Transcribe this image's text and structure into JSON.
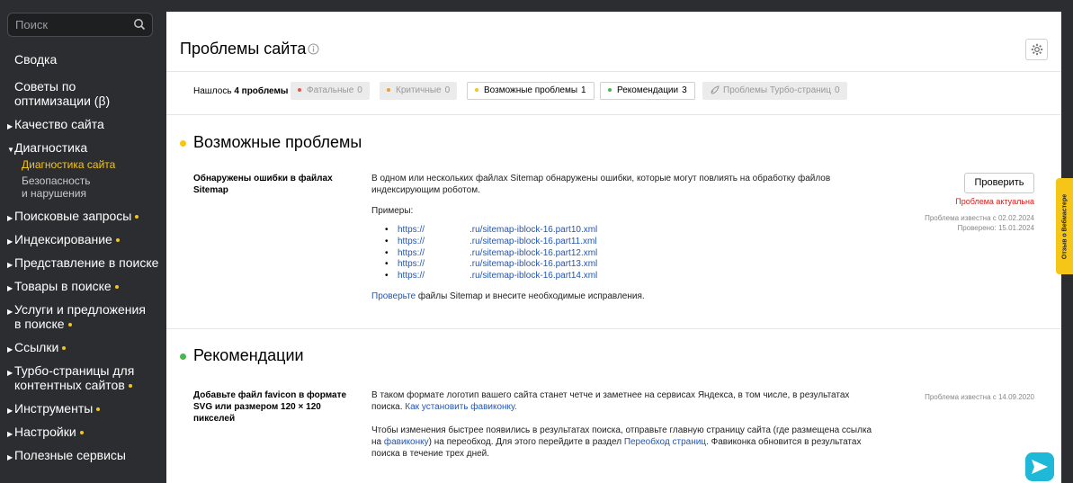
{
  "search": {
    "placeholder": "Поиск"
  },
  "nav": {
    "summary": "Сводка",
    "tips": "Советы по оптимизации (β)",
    "quality": "Качество сайта",
    "diagnostics": "Диагностика",
    "diag_site": "Диагностика сайта",
    "security": "Безопасность и нарушения",
    "queries": "Поисковые запросы",
    "indexing": "Индексирование",
    "presentation": "Представление в поиске",
    "goods": "Товары в поиске",
    "services": "Услуги и предложения в поиске",
    "links": "Ссылки",
    "turbo": "Турбо-страницы для контентных сайтов",
    "tools": "Инструменты",
    "settings": "Настройки",
    "useful": "Полезные сервисы"
  },
  "header": {
    "title": "Проблемы сайта"
  },
  "filters": {
    "found_prefix": "Нашлось ",
    "found_count": "4 проблемы",
    "fatal": {
      "label": "Фатальные",
      "count": "0",
      "color": "#e8534a"
    },
    "critical": {
      "label": "Критичные",
      "count": "0",
      "color": "#f29b38"
    },
    "possible": {
      "label": "Возможные проблемы",
      "count": "1",
      "color": "#f5c518"
    },
    "recommend": {
      "label": "Рекомендации",
      "count": "3",
      "color": "#47b84b"
    },
    "turbo": {
      "label": "Проблемы Турбо-страниц",
      "count": "0"
    }
  },
  "sections": {
    "possible": {
      "title": "Возможные проблемы",
      "issue": "Обнаружены ошибки в файлах Sitemap",
      "desc": "В одном или нескольких файлах Sitemap обнаружены ошибки, которые могут повлиять на обработку файлов индексирующим роботом.",
      "examples_label": "Примеры:",
      "examples": [
        {
          "a": "https://",
          "b": ".ru/sitemap-iblock-16.part10.xml"
        },
        {
          "a": "https://",
          "b": ".ru/sitemap-iblock-16.part11.xml"
        },
        {
          "a": "https://",
          "b": ".ru/sitemap-iblock-16.part12.xml"
        },
        {
          "a": "https://",
          "b": ".ru/sitemap-iblock-16.part13.xml"
        },
        {
          "a": "https://",
          "b": ".ru/sitemap-iblock-16.part14.xml"
        }
      ],
      "fix_link": "Проверьте",
      "fix_text": " файлы Sitemap и внесите необходимые исправления.",
      "check_btn": "Проверить",
      "status": "Проблема актуальна",
      "known": "Проблема известна с 02.02.2024",
      "checked": "Проверено: 15.01.2024"
    },
    "recommend": {
      "title": "Рекомендации",
      "issue": "Добавьте файл favicon в формате SVG или размером 120 × 120 пикселей",
      "p1_text": "В таком формате логотип вашего сайта станет четче и заметнее на сервисах Яндекса, в том числе, в результатах поиска. ",
      "p1_link": "Как установить фавиконку.",
      "p2_a": "Чтобы изменения быстрее появились в результатах поиска, отправьте главную страницу сайта (где размещена ссылка на ",
      "p2_link1": "фавиконку",
      "p2_b": ") на переобход. Для этого перейдите в раздел ",
      "p2_link2": "Переобход страниц",
      "p2_c": ". Фавиконка обновится в результатах поиска в течение трех дней.",
      "known": "Проблема известна с 14.09.2020"
    }
  },
  "feedback": {
    "label": "Отзыв о Вебмастере"
  }
}
